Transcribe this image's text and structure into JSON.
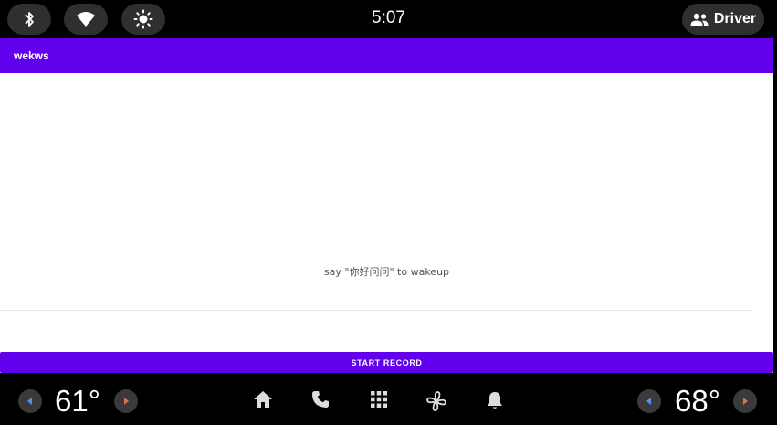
{
  "status_bar": {
    "time": "5:07",
    "user_label": "Driver",
    "icons": [
      "bluetooth-icon",
      "wifi-icon",
      "brightness-icon",
      "person-icon"
    ]
  },
  "app": {
    "title": "wekws",
    "hint_text": "say \"你好问问\" to wakeup",
    "start_record_label": "START RECORD",
    "accent_color": "#6200ee"
  },
  "nav_bar": {
    "left_temperature": "61°",
    "right_temperature": "68°",
    "icons": [
      "home-icon",
      "phone-icon",
      "apps-grid-icon",
      "fan-icon",
      "notification-bell-icon"
    ],
    "left_arrow_color": "#5b8def",
    "right_arrow_color": "#e07050"
  }
}
